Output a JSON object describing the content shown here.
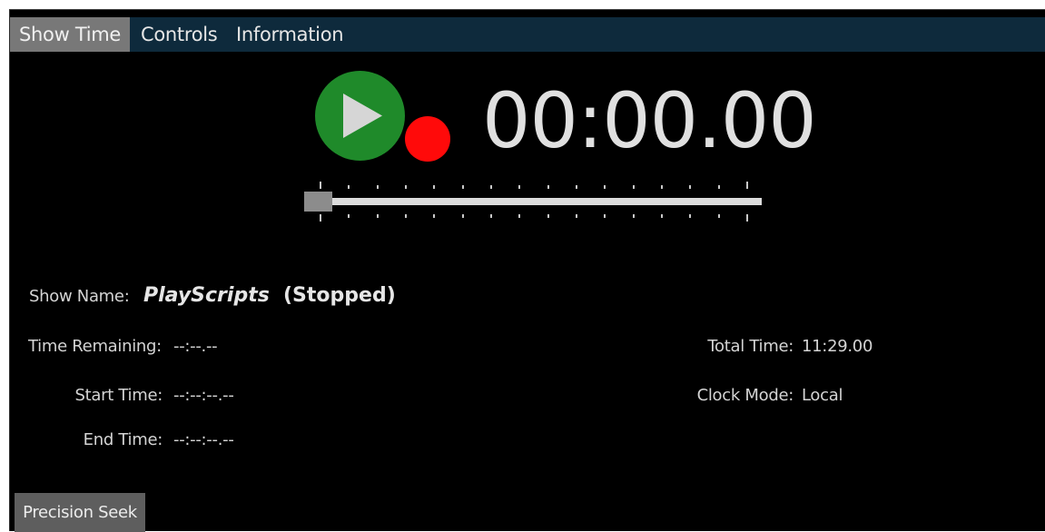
{
  "tabs": [
    {
      "label": "Show Time",
      "active": true
    },
    {
      "label": "Controls",
      "active": false
    },
    {
      "label": "Information",
      "active": false
    }
  ],
  "transport": {
    "play_icon": "play-icon",
    "record_indicator_color": "#ff0a0a",
    "play_color": "#1f8a2a",
    "clock": "00:00.00",
    "seek_position": 0
  },
  "show": {
    "name_label": "Show Name:",
    "name": "PlayScripts",
    "status": "(Stopped)"
  },
  "fields": {
    "time_remaining_label": "Time Remaining:",
    "time_remaining": "--:--.--",
    "start_time_label": "Start Time:",
    "start_time": "--:--:--.--",
    "end_time_label": "End Time:",
    "end_time": "--:--:--.--",
    "total_time_label": "Total Time:",
    "total_time": "11:29.00",
    "clock_mode_label": "Clock Mode:",
    "clock_mode": "Local"
  },
  "buttons": {
    "precision_seek": "Precision Seek"
  }
}
